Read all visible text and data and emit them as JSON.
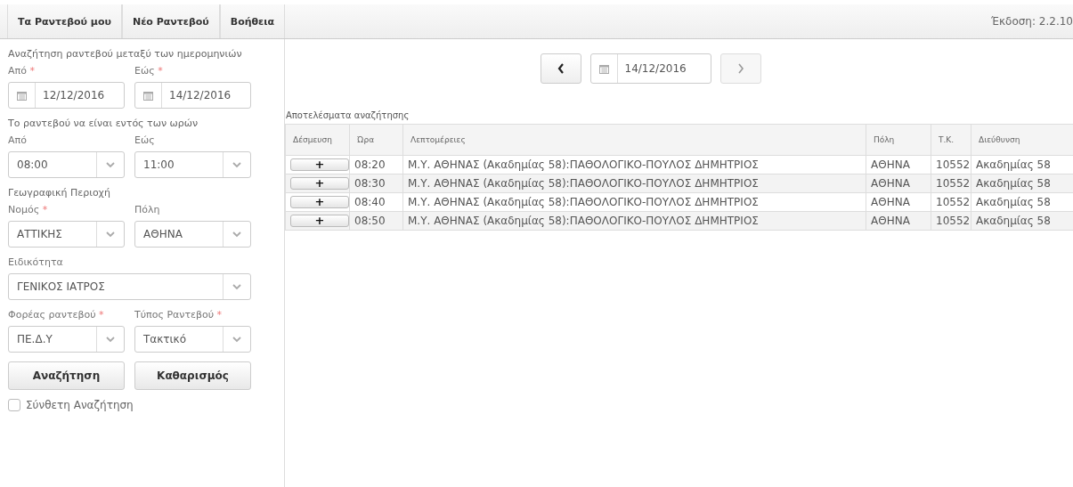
{
  "tabs": [
    {
      "label": "Τα Ραντεβού μου",
      "selected": false
    },
    {
      "label": "Νέο Ραντεβού",
      "selected": false
    },
    {
      "label": "Βοήθεια",
      "selected": false
    }
  ],
  "version": "Έκδοση: 2.2.10",
  "search_form": {
    "title": "Αναζήτηση ραντεβού μεταξύ των ημερομηνιών",
    "date_fields": [
      {
        "label": "Από",
        "required_mark": "*",
        "value": "12/12/2016"
      },
      {
        "label": "Εώς",
        "required_mark": "*",
        "value": "14/12/2016"
      }
    ],
    "hours_title": "Το ραντεβού να είναι εντός των ωρών",
    "hour_fields": [
      {
        "label": "Από",
        "value": "08:00"
      },
      {
        "label": "Εώς",
        "value": "11:00"
      }
    ],
    "region_title": "Γεωγραφική Περιοχή",
    "region_fields": [
      {
        "label": "Νομός",
        "required_mark": "*",
        "value": "ΑΤΤΙΚΗΣ"
      },
      {
        "label": "Πόλη",
        "value": "ΑΘΗΝΑ"
      }
    ],
    "specialty": {
      "label": "Ειδικότητα",
      "value": "ΓΕΝΙΚΟΣ ΙΑΤΡΟΣ"
    },
    "type_fields": [
      {
        "label": "Φορέας ραντεβού",
        "required_mark": "*",
        "value": "ΠΕ.Δ.Υ"
      },
      {
        "label": "Τύπος Ραντεβού",
        "required_mark": "*",
        "value": "Τακτικό"
      }
    ],
    "buttons": [
      "Αναζήτηση",
      "Καθαρισμός"
    ],
    "advanced": {
      "label": "Σύνθετη Αναζήτηση",
      "checked": false
    }
  },
  "date_nav": {
    "value": "14/12/2016"
  },
  "results": {
    "title": "Αποτελέσματα αναζήτησης",
    "columns": [
      "Δέσμευση",
      "Ώρα",
      "Λεπτομέρειες",
      "Πόλη",
      "Τ.Κ.",
      "Διεύθυνση"
    ],
    "rows": [
      {
        "button": "+",
        "time": "08:20",
        "details": "Μ.Υ. ΑΘΗΝΑΣ (Ακαδημίας 58):ΠΑΘΟΛΟΓΙΚΟ-ΠΟΥΛΟΣ ΔΗΜΗΤΡΙΟΣ",
        "city": "ΑΘΗΝΑ",
        "zip": "10552",
        "address": "Ακαδημίας 58"
      },
      {
        "button": "+",
        "time": "08:30",
        "details": "Μ.Υ. ΑΘΗΝΑΣ (Ακαδημίας 58):ΠΑΘΟΛΟΓΙΚΟ-ΠΟΥΛΟΣ ΔΗΜΗΤΡΙΟΣ",
        "city": "ΑΘΗΝΑ",
        "zip": "10552",
        "address": "Ακαδημίας 58"
      },
      {
        "button": "+",
        "time": "08:40",
        "details": "Μ.Υ. ΑΘΗΝΑΣ (Ακαδημίας 58):ΠΑΘΟΛΟΓΙΚΟ-ΠΟΥΛΟΣ ΔΗΜΗΤΡΙΟΣ",
        "city": "ΑΘΗΝΑ",
        "zip": "10552",
        "address": "Ακαδημίας 58"
      },
      {
        "button": "+",
        "time": "08:50",
        "details": "Μ.Υ. ΑΘΗΝΑΣ (Ακαδημίας 58):ΠΑΘΟΛΟΓΙΚΟ-ΠΟΥΛΟΣ ΔΗΜΗΤΡΙΟΣ",
        "city": "ΑΘΗΝΑ",
        "zip": "10552",
        "address": "Ακαδημίας 58"
      }
    ]
  }
}
